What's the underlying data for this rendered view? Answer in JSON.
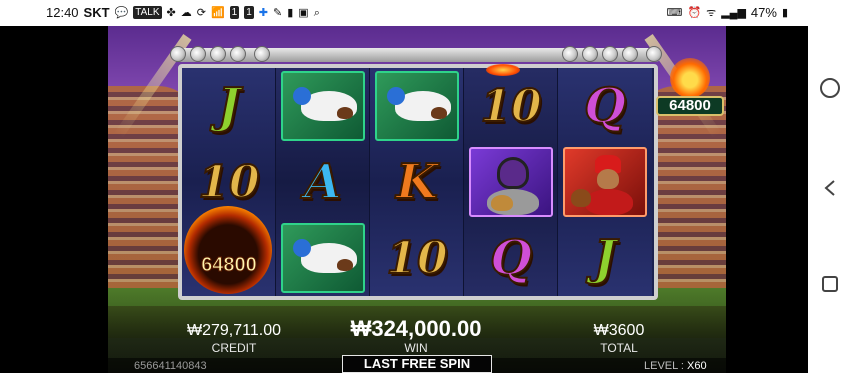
{
  "status_bar": {
    "time": "12:40",
    "carrier": "SKT",
    "battery": "47%"
  },
  "reels": [
    [
      "J",
      "10",
      "FIREBALL"
    ],
    [
      "SLIDING_PLAYER",
      "A",
      "SLIDING_PLAYER"
    ],
    [
      "SLIDING_PLAYER",
      "K",
      "10"
    ],
    [
      "10",
      "CATCHER",
      "Q"
    ],
    [
      "Q",
      "PITCHER",
      "J"
    ]
  ],
  "fireball_value": "64800",
  "jackpot_value": "64800",
  "hud": {
    "credit_value": "₩279,711.00",
    "credit_label": "CREDIT",
    "win_value": "₩324,000.00",
    "win_label": "WIN",
    "total_value": "₩3600",
    "total_label": "TOTAL",
    "banner": "LAST FREE SPIN",
    "game_id": "656641140843",
    "level_label": "LEVEL :",
    "level_value": "X60"
  },
  "colors": {
    "tile_green": "#2f9a5a",
    "tile_purple": "#7a3ad6",
    "tile_red": "#e03a2a",
    "frame": "#cfcfcf"
  }
}
